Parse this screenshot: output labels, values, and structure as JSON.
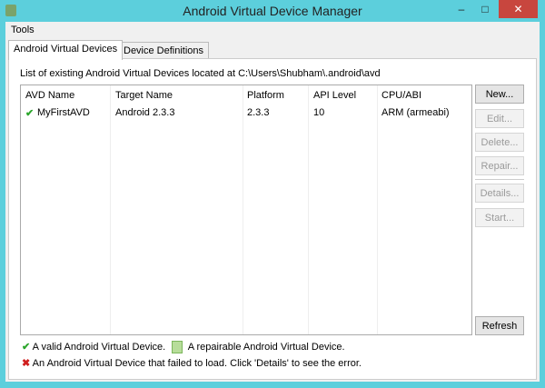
{
  "window": {
    "title": "Android Virtual Device Manager",
    "minimize": "–",
    "maximize": "□",
    "close": "✕"
  },
  "menu": {
    "tools": "Tools"
  },
  "tabs": [
    {
      "label": "Android Virtual Devices"
    },
    {
      "label": "Device Definitions"
    }
  ],
  "list_label": "List of existing Android Virtual Devices located at C:\\Users\\Shubham\\.android\\avd",
  "table": {
    "headers": [
      "AVD Name",
      "Target Name",
      "Platform",
      "API Level",
      "CPU/ABI"
    ],
    "rows": [
      {
        "status_icon": "✔",
        "avd_name": "MyFirstAVD",
        "target": "Android 2.3.3",
        "platform": "2.3.3",
        "api": "10",
        "cpu": "ARM (armeabi)"
      }
    ]
  },
  "buttons": {
    "new": "New...",
    "edit": "Edit...",
    "delete": "Delete...",
    "repair": "Repair...",
    "details": "Details...",
    "start": "Start...",
    "refresh": "Refresh"
  },
  "legend": {
    "valid_icon": "✔",
    "valid": "A valid Android Virtual Device.",
    "repairable": "A repairable Android Virtual Device.",
    "failed_icon": "✖",
    "failed": "An Android Virtual Device that failed to load. Click 'Details' to see the error."
  }
}
